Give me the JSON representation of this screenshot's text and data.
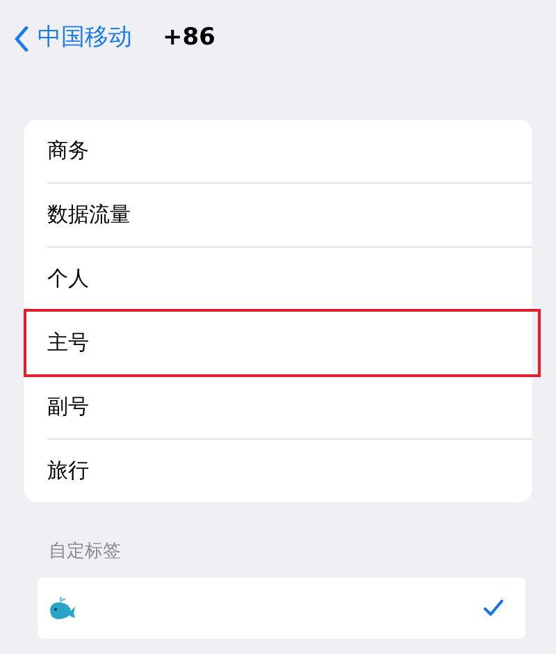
{
  "nav": {
    "back_label": "中国移动",
    "title": "+86"
  },
  "labels": [
    {
      "label": "商务",
      "highlighted": false,
      "selected": false
    },
    {
      "label": "数据流量",
      "highlighted": false,
      "selected": false
    },
    {
      "label": "个人",
      "highlighted": false,
      "selected": false
    },
    {
      "label": "主号",
      "highlighted": true,
      "selected": false
    },
    {
      "label": "副号",
      "highlighted": false,
      "selected": false
    },
    {
      "label": "旅行",
      "highlighted": false,
      "selected": false
    }
  ],
  "custom_section": {
    "header": "自定标签",
    "items": [
      {
        "kind": "picture",
        "selected": true
      }
    ]
  }
}
